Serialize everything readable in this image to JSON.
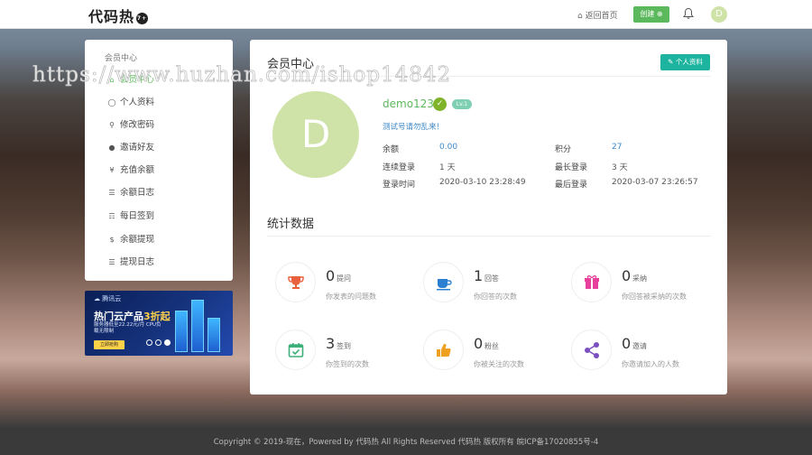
{
  "header": {
    "logo_text": "代码热",
    "logo_badge": "7+",
    "home_link": "返回首页",
    "create_label": "创建",
    "avatar_letter": "D"
  },
  "sidebar": {
    "title": "会员中心",
    "items": [
      {
        "label": "会员中心",
        "icon": "home-icon",
        "active": true
      },
      {
        "label": "个人资料",
        "icon": "user-icon"
      },
      {
        "label": "修改密码",
        "icon": "key-icon"
      },
      {
        "label": "邀请好友",
        "icon": "users-icon"
      },
      {
        "label": "充值余额",
        "icon": "yen-icon"
      },
      {
        "label": "余额日志",
        "icon": "list-icon"
      },
      {
        "label": "每日签到",
        "icon": "calendar-icon"
      },
      {
        "label": "余额提现",
        "icon": "dollar-icon"
      },
      {
        "label": "提现日志",
        "icon": "list-icon"
      }
    ]
  },
  "ad": {
    "brand": "腾讯云",
    "title_main": "热门云产品",
    "title_highlight": "3折起",
    "subtitle": "服务器低至22.22元/月 CPU负载无限制",
    "button": "立即抢购"
  },
  "main": {
    "title": "会员中心",
    "profile_button": "个人资料",
    "avatar_letter": "D",
    "username": "demo123",
    "level": "Lv.1",
    "motto": "测试号请勿乱来！",
    "info": [
      {
        "label": "余额",
        "value": "0.00",
        "link": true
      },
      {
        "label": "积分",
        "value": "27",
        "link": true
      },
      {
        "label": "连续登录",
        "value": "1 天"
      },
      {
        "label": "最长登录",
        "value": "3 天"
      },
      {
        "label": "登录时间",
        "value": "2020-03-10 23:28:49"
      },
      {
        "label": "最后登录",
        "value": "2020-03-07 23:26:57"
      }
    ],
    "stats_title": "统计数据",
    "stats": [
      {
        "num": "0",
        "label": "提问",
        "desc": "你发表的问题数",
        "icon": "trophy-icon",
        "color": "#e8603c"
      },
      {
        "num": "1",
        "label": "回答",
        "desc": "你回答的次数",
        "icon": "coffee-cup-icon",
        "color": "#2a7fd0"
      },
      {
        "num": "0",
        "label": "采纳",
        "desc": "你回答被采纳的次数",
        "icon": "gift-icon",
        "color": "#e8409b"
      },
      {
        "num": "3",
        "label": "签到",
        "desc": "你签到的次数",
        "icon": "calendar-check-icon",
        "color": "#3db07a"
      },
      {
        "num": "0",
        "label": "粉丝",
        "desc": "你被关注的次数",
        "icon": "thumbs-up-icon",
        "color": "#f0a020"
      },
      {
        "num": "0",
        "label": "邀请",
        "desc": "你邀请加入的人数",
        "icon": "share-icon",
        "color": "#7b4fbf"
      }
    ]
  },
  "footer": {
    "text": "Copyright © 2019-现在，Powered by 代码热 All Rights Reserved 代码热 版权所有 皖ICP备17020855号-4"
  },
  "watermark": "https://www.huzhan.com/ishop14842",
  "colors": {
    "accent_green": "#5cb85c",
    "teal": "#1cb49e",
    "link_blue": "#3f89c8",
    "avatar_bg": "#cfe3a8"
  }
}
